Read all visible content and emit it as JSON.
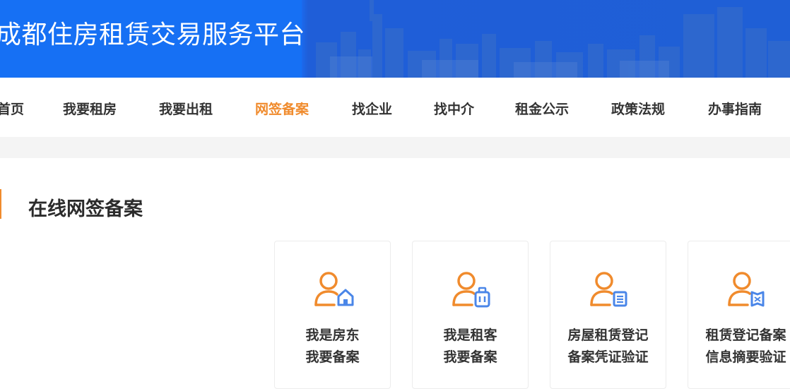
{
  "header": {
    "site_title": "成都住房租赁交易服务平台",
    "brand_color": "#1670f4"
  },
  "nav": {
    "items": [
      {
        "label": "首页"
      },
      {
        "label": "我要租房"
      },
      {
        "label": "我要出租"
      },
      {
        "label": "网签备案",
        "active": true
      },
      {
        "label": "找企业"
      },
      {
        "label": "找中介"
      },
      {
        "label": "租金公示"
      },
      {
        "label": "政策法规"
      },
      {
        "label": "办事指南"
      }
    ],
    "active_color": "#f08b2d"
  },
  "section": {
    "title": "在线网签备案",
    "accent_color": "#f08b2d"
  },
  "cards": [
    {
      "icon": "landlord-house-icon",
      "line1": "我是房东",
      "line2": "我要备案"
    },
    {
      "icon": "tenant-luggage-icon",
      "line1": "我是租客",
      "line2": "我要备案"
    },
    {
      "icon": "document-verify-icon",
      "line1": "房屋租赁登记",
      "line2": "备案凭证验证"
    },
    {
      "icon": "summary-verify-icon",
      "line1": "租赁登记备案",
      "line2": "信息摘要验证"
    }
  ]
}
